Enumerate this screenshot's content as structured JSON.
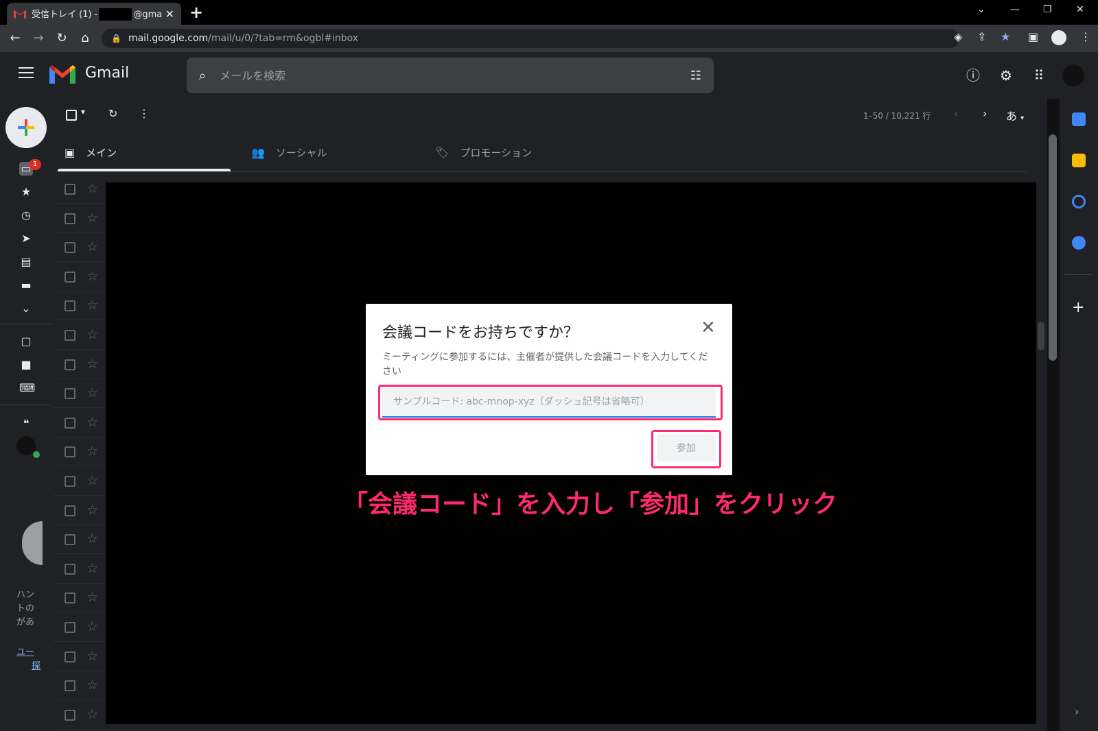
{
  "browser": {
    "tab_title_prefix": "受信トレイ (1) -",
    "tab_title_suffix": "@gmail.co",
    "url_host": "mail.google.com",
    "url_path": "/mail/u/0/?tab=rm&ogbl#inbox"
  },
  "gmail": {
    "app_name": "Gmail",
    "search_placeholder": "メールを検索",
    "pager": "1–50 / 10,221 行",
    "input_tool": "あ",
    "unread_badge": "1",
    "tabs": [
      {
        "label": "メイン",
        "icon": "inbox-icon"
      },
      {
        "label": "ソーシャル",
        "icon": "people-icon"
      },
      {
        "label": "プロモーション",
        "icon": "tag-icon"
      }
    ],
    "chat_text": [
      "ハン",
      "トの",
      "があ",
      "ユー",
      "探"
    ]
  },
  "dialog": {
    "title": "会議コードをお持ちですか？",
    "description": "ミーティングに参加するには、主催者が提供した会議コードを入力してください",
    "code_placeholder": "サンプルコード: abc-mnop-xyz（ダッシュ記号は省略可）",
    "join_label": "参加"
  },
  "annotation": {
    "text": "「会議コード」を入力し「参加」をクリック",
    "color": "#ff2a6d"
  },
  "colors": {
    "accent": "#1a73e8",
    "highlight": "#ff2a6d",
    "badge": "#d93025"
  }
}
